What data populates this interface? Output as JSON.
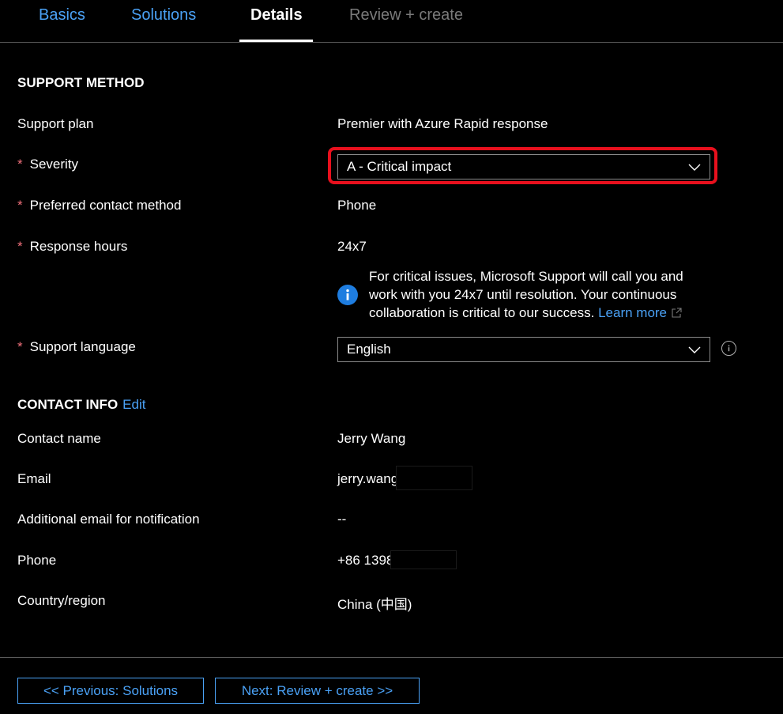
{
  "tabs": [
    {
      "label": "Basics",
      "state": "link"
    },
    {
      "label": "Solutions",
      "state": "link"
    },
    {
      "label": "Details",
      "state": "active"
    },
    {
      "label": "Review + create",
      "state": "disabled"
    }
  ],
  "support_method": {
    "title": "SUPPORT METHOD",
    "support_plan": {
      "label": "Support plan",
      "value": "Premier with Azure Rapid response"
    },
    "severity": {
      "label": "Severity",
      "value": "A - Critical impact",
      "required": true
    },
    "contact_method": {
      "label": "Preferred contact method",
      "value": "Phone",
      "required": true
    },
    "response_hours": {
      "label": "Response hours",
      "value": "24x7",
      "required": true
    },
    "info": {
      "text": "For critical issues, Microsoft Support will call you and work with you 24x7 until resolution. Your continuous collaboration is critical to our success.",
      "link": "Learn more"
    },
    "support_language": {
      "label": "Support language",
      "value": "English",
      "required": true
    }
  },
  "contact_info": {
    "title": "CONTACT INFO",
    "edit_label": "Edit",
    "contact_name": {
      "label": "Contact name",
      "value": "Jerry Wang"
    },
    "email": {
      "label": "Email",
      "value": "jerry.wang"
    },
    "additional_email": {
      "label": "Additional email for notification",
      "value": "--"
    },
    "phone": {
      "label": "Phone",
      "value": "+86 1398"
    },
    "country": {
      "label": "Country/region",
      "value": "China (中国)"
    }
  },
  "required_marker": "*",
  "footer": {
    "previous_label": "<< Previous: Solutions",
    "next_label": "Next: Review + create >>"
  },
  "colors": {
    "background": "#000000",
    "link": "#4aa1f5",
    "highlight": "#e8101d",
    "info_icon": "#1e7de0",
    "required": "#f1707b"
  }
}
